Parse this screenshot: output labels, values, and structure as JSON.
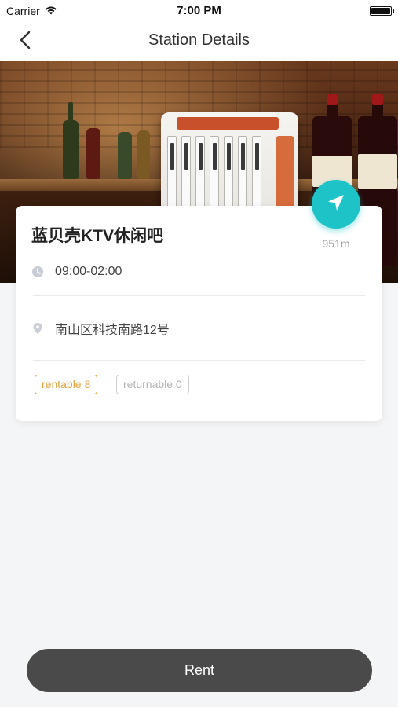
{
  "status_bar": {
    "carrier": "Carrier",
    "time": "7:00 PM"
  },
  "nav": {
    "title": "Station Details"
  },
  "station": {
    "name": "蓝贝壳KTV休闲吧",
    "hours": "09:00-02:00",
    "address": "南山区科技南路12号",
    "distance": "951m",
    "tags": {
      "rentable": "rentable 8",
      "returnable": "returnable 0"
    }
  },
  "actions": {
    "rent_label": "Rent"
  },
  "colors": {
    "accent_teal": "#1ec3c7",
    "rentable_orange": "#e2a23c",
    "returnable_gray": "#b4b4b4",
    "rent_button_bg": "#4a4a4a"
  },
  "icons": {
    "back": "chevron-left-icon",
    "wifi": "wifi-icon",
    "battery": "battery-icon",
    "navigate": "navigation-arrow-icon",
    "clock": "clock-icon",
    "location": "location-pin-icon"
  }
}
